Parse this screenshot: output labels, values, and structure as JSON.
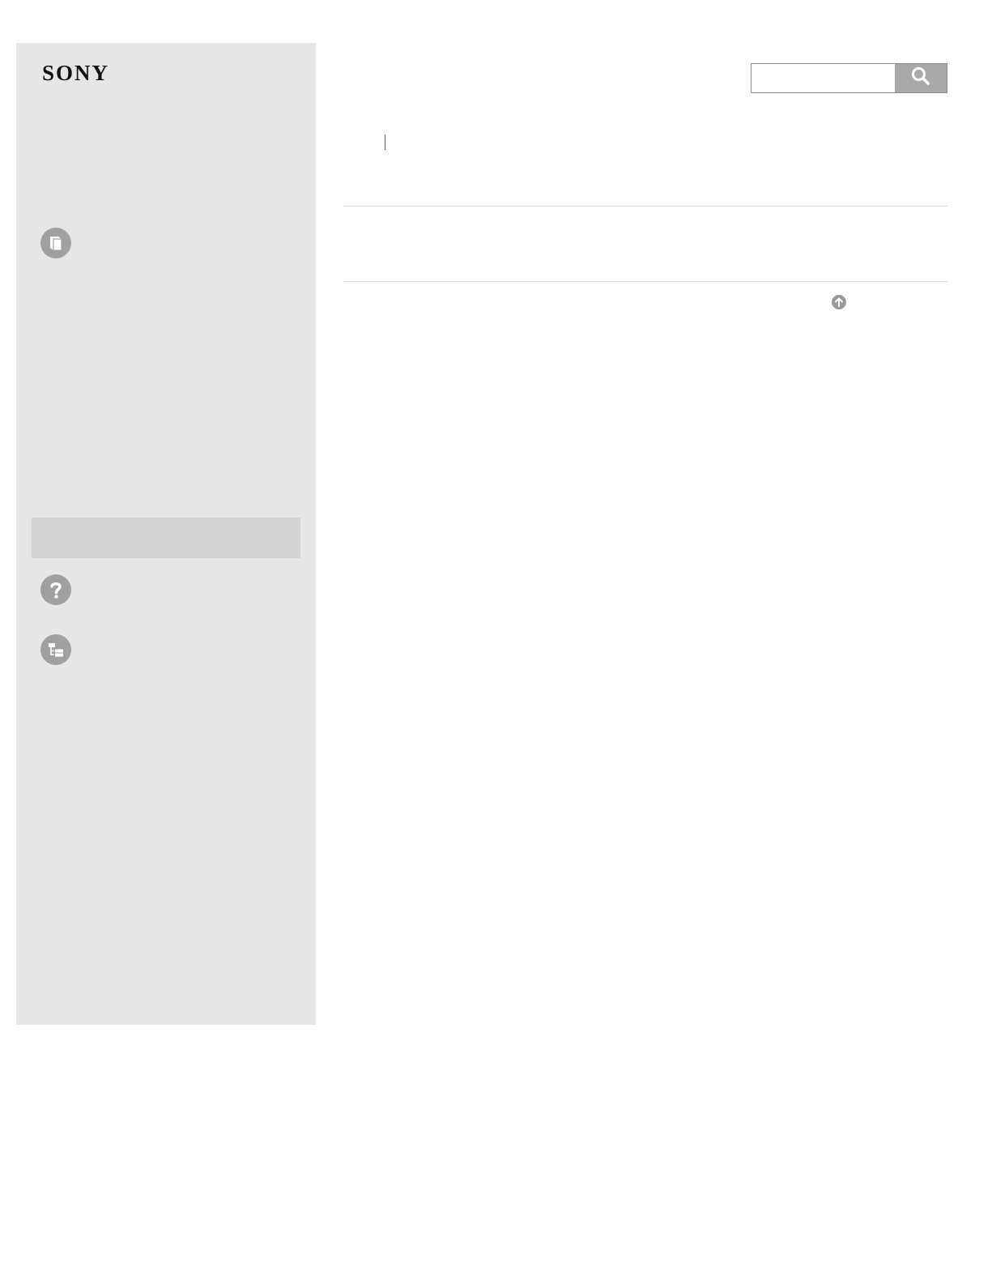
{
  "brand": {
    "logo_text": "SONY"
  },
  "search": {
    "value": "",
    "placeholder": ""
  },
  "icons": {
    "manual": "book-icon",
    "help": "question-icon",
    "contents": "tree-list-icon",
    "search": "magnifier-icon",
    "back_to_top": "arrow-up-circle-icon"
  },
  "colors": {
    "sidebar_bg": "#e6e6e6",
    "highlight_bg": "#d3d3d3",
    "icon_gray": "#a0a0a0",
    "search_button_bg": "#a9a9a9"
  }
}
